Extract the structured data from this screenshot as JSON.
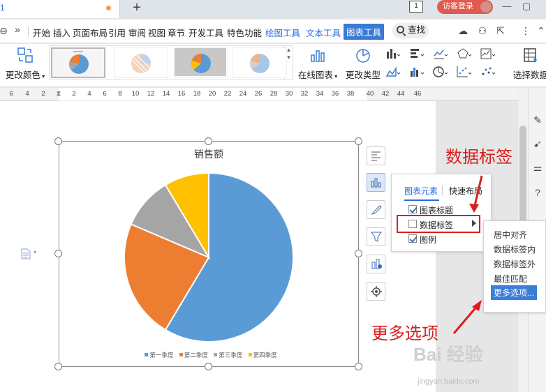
{
  "titlebar": {
    "tab_number": "1",
    "new_tab": "+",
    "page_indicator": "1",
    "login_label": "访客登录"
  },
  "menu": {
    "items": [
      "开始",
      "插入",
      "页面布局",
      "引用",
      "审阅",
      "视图",
      "章节",
      "开发工具",
      "特色功能",
      "绘图工具",
      "文本工具",
      "图表工具"
    ],
    "search_label": "查找"
  },
  "ribbon": {
    "change_color": "更改颜色",
    "online_chart": "在线图表",
    "change_type": "更改类型",
    "select_data": "选择数据"
  },
  "ruler": {
    "ticks": [
      "6",
      "4",
      "2",
      "",
      "2",
      "4",
      "6",
      "8",
      "10",
      "12",
      "14",
      "16",
      "18",
      "20",
      "22",
      "24",
      "26",
      "28",
      "30",
      "32",
      "34",
      "36",
      "38",
      "40",
      "42",
      "44",
      "46"
    ]
  },
  "chart_data": {
    "type": "pie",
    "title": "销售额",
    "categories": [
      "第一季度",
      "第二季度",
      "第三季度",
      "第四季度"
    ],
    "values": [
      8.2,
      3.2,
      1.4,
      1.2
    ],
    "colors": [
      "#5b9bd5",
      "#ed7d31",
      "#a5a5a5",
      "#ffc000"
    ],
    "legend_position": "bottom"
  },
  "popup": {
    "tab_elements": "图表元素",
    "tab_quick_layout": "快速布局",
    "items": [
      {
        "label": "图表标题",
        "checked": true
      },
      {
        "label": "数据标签",
        "checked": false
      },
      {
        "label": "图例",
        "checked": true
      }
    ]
  },
  "submenu": {
    "items": [
      "居中对齐",
      "数据标签内",
      "数据标签外",
      "最佳匹配",
      "更多选项..."
    ]
  },
  "annotations": {
    "data_label_callout": "数据标签",
    "more_options_callout": "更多选项"
  },
  "watermark": {
    "main": "Bai 经验",
    "sub": "jingyan.baidu.com"
  }
}
